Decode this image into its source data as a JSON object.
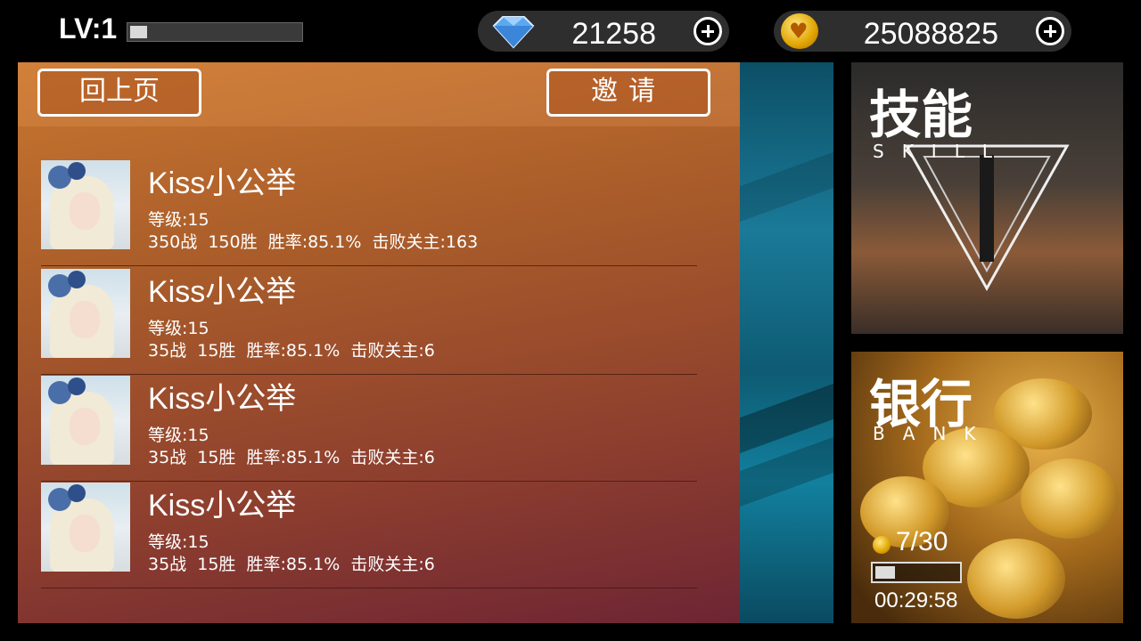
{
  "top": {
    "level_label": "LV:1",
    "xp_fraction": 0.1,
    "gems": "21258",
    "coins": "25088825"
  },
  "panel": {
    "back_label": "回上页",
    "invite_label": "邀请"
  },
  "friends": [
    {
      "name": "Kiss小公举",
      "level": "等级:15",
      "stats": "350战  150胜  胜率:85.1%  击败关主:163"
    },
    {
      "name": "Kiss小公举",
      "level": "等级:15",
      "stats": "35战  15胜  胜率:85.1%  击败关主:6"
    },
    {
      "name": "Kiss小公举",
      "level": "等级:15",
      "stats": "35战  15胜  胜率:85.1%  击败关主:6"
    },
    {
      "name": "Kiss小公举",
      "level": "等级:15",
      "stats": "35战  15胜  胜率:85.1%  击败关主:6"
    }
  ],
  "skill_card": {
    "title": "技能",
    "subtitle": "SKILL"
  },
  "bank_card": {
    "title": "银行",
    "subtitle": "BANK",
    "count": "7/30",
    "fill_fraction": 0.23,
    "timer": "00:29:58"
  },
  "colors": {
    "gem": "#5aa8f0",
    "coin": "#f0b400",
    "accent_border": "#ffffff"
  },
  "icons": {
    "gem": "diamond-icon",
    "coin": "heart-coin-icon",
    "add": "plus-circle-icon"
  }
}
